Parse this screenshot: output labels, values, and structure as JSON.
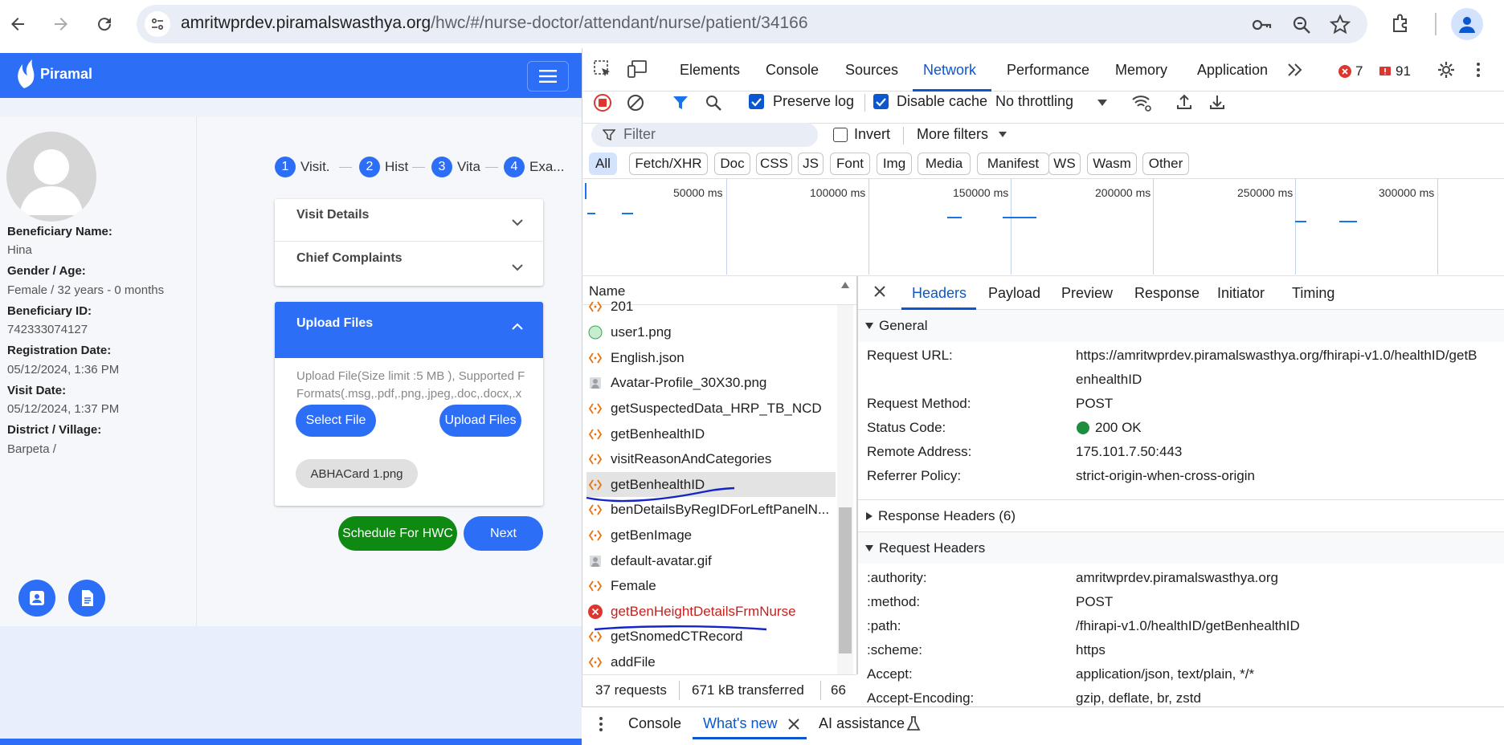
{
  "browser": {
    "url_host": "amritwprdev.piramalswasthya.org",
    "url_path": "/hwc/#/nurse-doctor/attendant/nurse/patient/34166"
  },
  "app": {
    "logo_text": "Piramal",
    "beneficiary": [
      {
        "label": "Beneficiary Name:",
        "value": "Hina"
      },
      {
        "label": "Gender / Age:",
        "value": "Female / 32 years - 0 months"
      },
      {
        "label": "Beneficiary ID:",
        "value": "742333074127"
      },
      {
        "label": "Registration Date:",
        "value": "05/12/2024, 1:36 PM"
      },
      {
        "label": "Visit Date:",
        "value": "05/12/2024, 1:37 PM"
      },
      {
        "label": "District / Village:",
        "value": "Barpeta /"
      }
    ],
    "steps": [
      {
        "num": "1",
        "label": "Visit."
      },
      {
        "num": "2",
        "label": "Hist"
      },
      {
        "num": "3",
        "label": "Vita"
      },
      {
        "num": "4",
        "label": "Exa..."
      }
    ],
    "visit_details": "Visit Details",
    "chief_complaints": "Chief Complaints",
    "upload_files_title": "Upload Files",
    "upload_hint_1": "Upload File(Size limit :5 MB ), Supported F",
    "upload_hint_2": "Formats(.msg,.pdf,.png,.jpeg,.doc,.docx,.x",
    "select_file": "Select File",
    "upload_files_btn": "Upload Files",
    "file_chip": "ABHACard 1.png",
    "schedule_btn": "Schedule For HWC",
    "next_btn": "Next"
  },
  "devtools": {
    "tabs": [
      "Elements",
      "Console",
      "Sources",
      "Network",
      "Performance",
      "Memory",
      "Application"
    ],
    "active_tab": "Network",
    "error_count": "7",
    "warning_count": "91",
    "preserve_log": "Preserve log",
    "disable_cache": "Disable cache",
    "throttling": "No throttling",
    "filter_placeholder": "Filter",
    "invert": "Invert",
    "more_filters": "More filters",
    "type_chips": [
      "All",
      "Fetch/XHR",
      "Doc",
      "CSS",
      "JS",
      "Font",
      "Img",
      "Media",
      "Manifest",
      "WS",
      "Wasm",
      "Other"
    ],
    "timeline_labels": [
      "50000 ms",
      "100000 ms",
      "150000 ms",
      "200000 ms",
      "250000 ms",
      "300000 ms"
    ],
    "name_header": "Name",
    "requests": [
      {
        "name": "201",
        "type": "xhr"
      },
      {
        "name": "user1.png",
        "type": "img-green"
      },
      {
        "name": "English.json",
        "type": "xhr"
      },
      {
        "name": "Avatar-Profile_30X30.png",
        "type": "img-grey"
      },
      {
        "name": "getSuspectedData_HRP_TB_NCD",
        "type": "xhr"
      },
      {
        "name": "getBenhealthID",
        "type": "xhr"
      },
      {
        "name": "visitReasonAndCategories",
        "type": "xhr"
      },
      {
        "name": "getBenhealthID",
        "type": "xhr",
        "selected": true
      },
      {
        "name": "benDetailsByRegIDForLeftPanelN...",
        "type": "xhr"
      },
      {
        "name": "getBenImage",
        "type": "xhr"
      },
      {
        "name": "default-avatar.gif",
        "type": "img-grey"
      },
      {
        "name": "Female",
        "type": "xhr"
      },
      {
        "name": "getBenHeightDetailsFrmNurse",
        "type": "error"
      },
      {
        "name": "getSnomedCTRecord",
        "type": "xhr"
      },
      {
        "name": "addFile",
        "type": "xhr"
      }
    ],
    "detail_tabs": [
      "Headers",
      "Payload",
      "Preview",
      "Response",
      "Initiator",
      "Timing"
    ],
    "active_detail_tab": "Headers",
    "general_title": "General",
    "general": [
      {
        "key": "Request URL:",
        "value": "https://amritwprdev.piramalswasthya.org/fhirapi-v1.0/healthID/getB"
      },
      {
        "key": "",
        "value": "enhealthID"
      },
      {
        "key": "Request Method:",
        "value": "POST"
      },
      {
        "key": "Status Code:",
        "value": "200 OK"
      },
      {
        "key": "Remote Address:",
        "value": "175.101.7.50:443"
      },
      {
        "key": "Referrer Policy:",
        "value": "strict-origin-when-cross-origin"
      }
    ],
    "response_headers_title": "Response Headers (6)",
    "request_headers_title": "Request Headers",
    "request_headers": [
      {
        "key": ":authority:",
        "value": "amritwprdev.piramalswasthya.org"
      },
      {
        "key": ":method:",
        "value": "POST"
      },
      {
        "key": ":path:",
        "value": "/fhirapi-v1.0/healthID/getBenhealthID"
      },
      {
        "key": ":scheme:",
        "value": "https"
      },
      {
        "key": "Accept:",
        "value": "application/json, text/plain, */*"
      },
      {
        "key": "Accept-Encoding:",
        "value": "gzip, deflate, br, zstd"
      }
    ],
    "status_requests": "37 requests",
    "status_transferred": "671 kB transferred",
    "status_extra": "66",
    "drawer_tabs": [
      "Console",
      "What's new",
      "AI assistance"
    ],
    "active_drawer_tab": "What's new",
    "colors": {
      "accent": "#0b57d0",
      "app_blue": "#2d6ef6",
      "schedule_green": "#0e8a12",
      "error_red": "#c5221f"
    }
  }
}
